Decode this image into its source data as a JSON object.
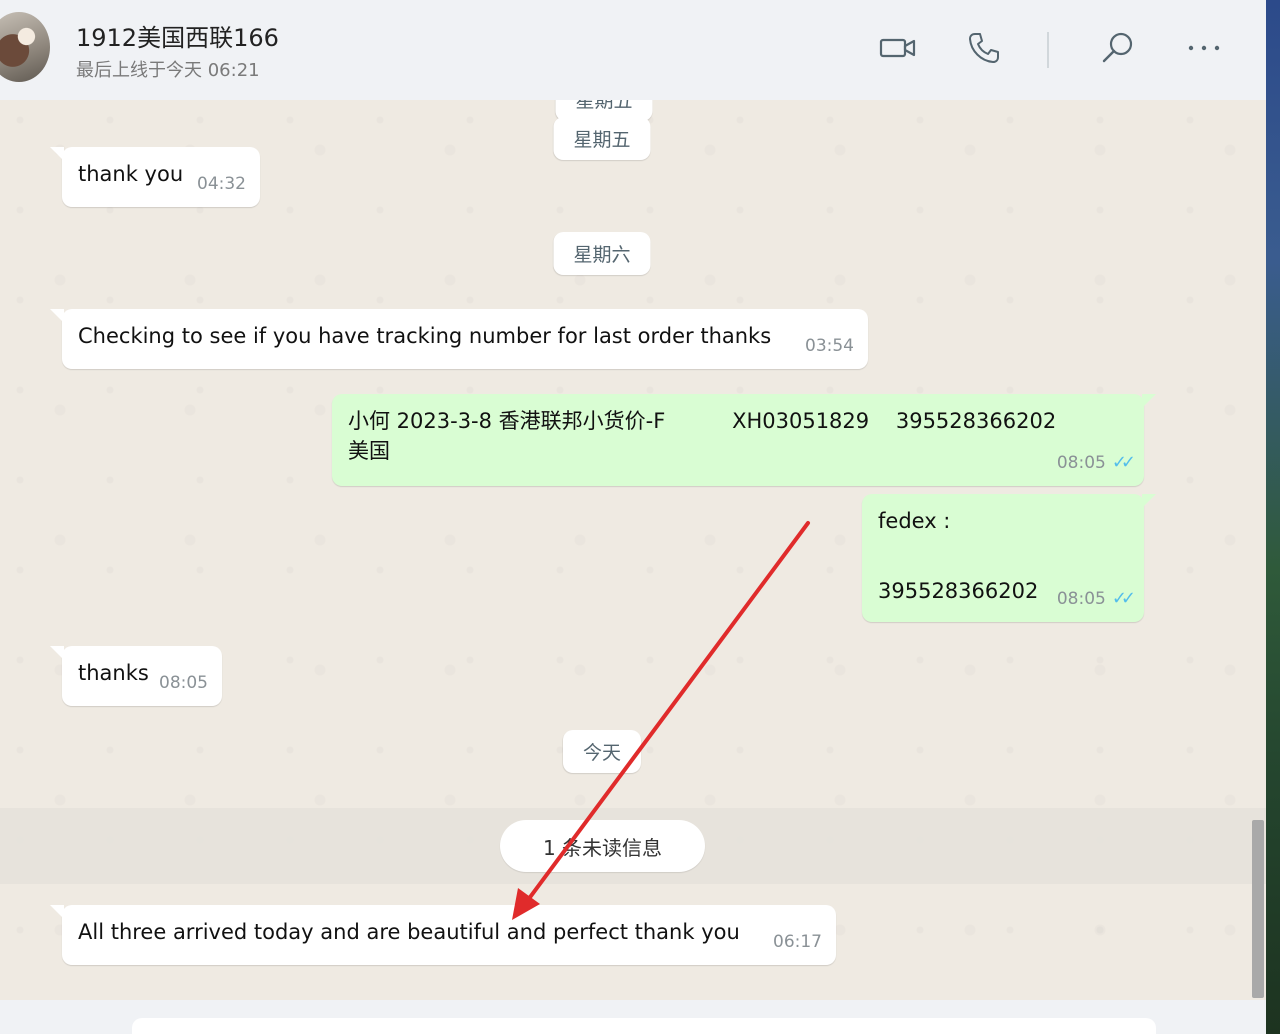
{
  "header": {
    "contact_name": "1912美国西联166",
    "last_seen": "最后上线于今天 06:21",
    "icons": [
      "video-call-icon",
      "voice-call-icon",
      "search-icon",
      "more-options-icon"
    ]
  },
  "chat": {
    "top_partial_chip": "星期五",
    "date_chips": [
      "星期五",
      "星期六",
      "今天"
    ],
    "messages": [
      {
        "direction": "in",
        "text": "thank you",
        "time": "04:32"
      },
      {
        "direction": "in",
        "text": "Checking to see if you have tracking number for last order thanks",
        "time": "03:54"
      },
      {
        "direction": "out",
        "line1": "小何 2023-3-8 香港联邦小货价-F          XH03051829    395528366202",
        "line2": "美国",
        "time": "08:05",
        "status": "read"
      },
      {
        "direction": "out",
        "line1": "fedex :",
        "line2": "395528366202",
        "time": "08:05",
        "status": "read"
      },
      {
        "direction": "in",
        "text": "thanks",
        "time": "08:05"
      },
      {
        "direction": "in",
        "text": "All three arrived today and are beautiful and perfect thank you",
        "time": "06:17"
      }
    ],
    "unread_label": "1 条未读信息"
  },
  "colors": {
    "incoming_bubble": "#ffffff",
    "outgoing_bubble": "#d9fdd3",
    "read_ticks": "#53bdeb",
    "annotation_arrow": "#e02b2b",
    "chat_background": "#efeae2"
  }
}
